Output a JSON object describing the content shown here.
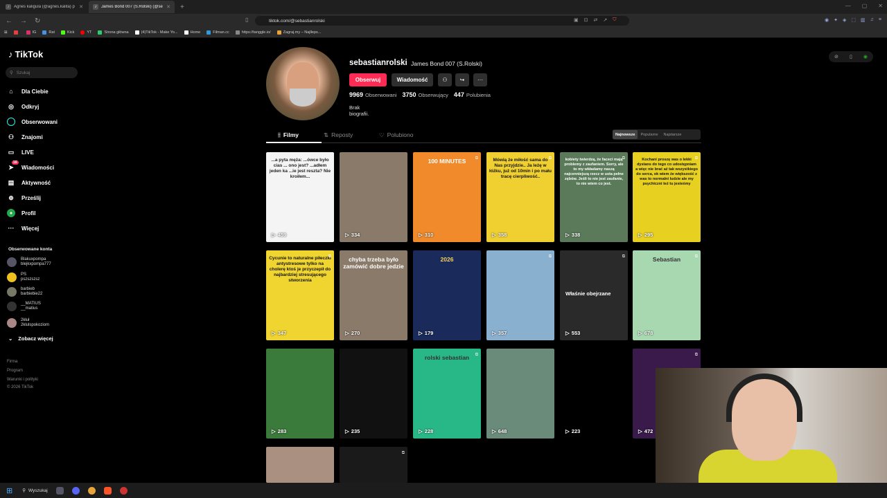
{
  "browser": {
    "tabs": [
      {
        "title": "Agnes kaligula (@agnes.kalita) p",
        "active": false
      },
      {
        "title": "James Bond 007 (S.Rolski) (@se",
        "active": true
      }
    ],
    "new_tab": "+",
    "url": "tiktok.com/@sebastianrolski",
    "bookmarks": [
      {
        "label": "",
        "color": "#e04040"
      },
      {
        "label": "IG",
        "color": "#d6336c"
      },
      {
        "label": "Rat",
        "color": "#4a90e2"
      },
      {
        "label": "Kick",
        "color": "#53fc18"
      },
      {
        "label": "YT",
        "color": "#ff0000"
      },
      {
        "label": "Strona główna",
        "color": "#2ecc71"
      },
      {
        "label": "(4)TikTok - Make Yo...",
        "color": "#ffffff"
      },
      {
        "label": "Home",
        "color": "#ffffff"
      },
      {
        "label": "Filman.cc",
        "color": "#3498db"
      },
      {
        "label": "https://tanggle.io/",
        "color": "#888888"
      },
      {
        "label": "Zagraj.my – Najlleps...",
        "color": "#e8a33c"
      }
    ]
  },
  "sidebar": {
    "logo": "TikTok",
    "search_placeholder": "Szukaj",
    "nav": [
      {
        "label": "Dla Ciebie",
        "icon": "home-icon"
      },
      {
        "label": "Odkryj",
        "icon": "compass-icon"
      },
      {
        "label": "Obserwowani",
        "icon": "following-icon"
      },
      {
        "label": "Znajomi",
        "icon": "friends-icon"
      },
      {
        "label": "LIVE",
        "icon": "live-icon"
      },
      {
        "label": "Wiadomości",
        "icon": "messages-icon",
        "badge": "16"
      },
      {
        "label": "Aktywność",
        "icon": "activity-icon"
      },
      {
        "label": "Prześlij",
        "icon": "upload-icon"
      },
      {
        "label": "Profil",
        "icon": "profile-icon"
      },
      {
        "label": "Więcej",
        "icon": "more-icon"
      }
    ],
    "followed_heading": "Obserwowane konta",
    "followed": [
      {
        "name": "Blakuxpompa",
        "handle": "blejkxpompa777"
      },
      {
        "name": "PS",
        "handle": "pszszszsz"
      },
      {
        "name": "barbieb",
        "handle": "barbiebie22"
      },
      {
        "name": "__MATIUS",
        "handle": "__matius"
      },
      {
        "name": "2kłuł",
        "handle": "2klulspokoziom"
      }
    ],
    "see_more": "Zobacz więcej",
    "footer": [
      "Firma",
      "Program",
      "Warunki i polityki",
      "© 2026 TikTok"
    ]
  },
  "profile": {
    "username": "sebastianrolski",
    "display_name": "James Bond 007 (S.Rolski)",
    "follow_label": "Obserwuj",
    "message_label": "Wiadomość",
    "stats": [
      {
        "value": "9969",
        "label": "Obserwowani"
      },
      {
        "value": "3750",
        "label": "Obserwujący"
      },
      {
        "value": "447",
        "label": "Polubienia"
      }
    ],
    "bio": "Brak biografii.",
    "tabs": [
      "Filmy",
      "Reposty",
      "Polubiono"
    ],
    "sort": [
      "Najnowsze",
      "Popularne",
      "Najstarsze"
    ]
  },
  "videos": [
    {
      "views": "459",
      "caption": "...a pyta męża: ...ówce było cias ... ono jest? ...adłem jeden ka ...ie jest reszta? Nie kroiłem...",
      "bg": "#f4f4f4",
      "fg": "#222",
      "pinned": false
    },
    {
      "views": "334",
      "caption": "",
      "bg": "#8a7a6a",
      "fg": "#fff",
      "pinned": false
    },
    {
      "views": "310",
      "caption": "100 MINUTES",
      "bg": "#f08a2a",
      "fg": "#fff",
      "pinned": true
    },
    {
      "views": "358",
      "caption": "Mówią że miłość sama do Nas przyjdzie.. Ja leżę w łóżku, już od 10min i po mału tracę cierpliwość..",
      "bg": "#f0d030",
      "fg": "#111",
      "pinned": true
    },
    {
      "views": "338",
      "caption": "kobiety twierdzą, że faceci mają problemy z zaufaniem. Sorry, ale to my wkładamy naszą najcenniejszą rzecz w usta pełne zębów. Jeśli to nie jest zaufanie, to nie wiem co jest.",
      "bg": "#5a7a5a",
      "fg": "#fff",
      "pinned": true
    },
    {
      "views": "295",
      "caption": "Kochani proszę was o lekki dystans do tego co udostępniam a więc nie brać aż tak wszystkiego do serca, ok wiem że większość z was to normalni ludzie ale my psychiczni też tu jesteśmy",
      "bg": "#e8d020",
      "fg": "#111",
      "pinned": true
    },
    {
      "views": "347",
      "caption": "Cycunie to naturalne piłeczki antystresowe tylko na cholerę ktoś je przyczepił do najbardziej stresującego stworzenia",
      "bg": "#f0d430",
      "fg": "#111",
      "pinned": true
    },
    {
      "views": "270",
      "caption": "chyba trzeba było zamówić dobre jedzie",
      "bg": "#8a7a6a",
      "fg": "#fff",
      "pinned": false
    },
    {
      "views": "179",
      "caption": "2026",
      "bg": "#1a2a5a",
      "fg": "#f4d060",
      "pinned": false
    },
    {
      "views": "357",
      "caption": "",
      "bg": "#8ab0d0",
      "fg": "#fff",
      "pinned": true
    },
    {
      "views": "553",
      "caption": "",
      "bg": "#2a2a2a",
      "fg": "#fff",
      "pinned": true,
      "watched": "Właśnie obejrzane"
    },
    {
      "views": "678",
      "caption": "Sebastian",
      "bg": "#a8d8b0",
      "fg": "#333",
      "pinned": true
    },
    {
      "views": "283",
      "caption": "",
      "bg": "#3a7a3a",
      "fg": "#fff",
      "pinned": false
    },
    {
      "views": "235",
      "caption": "",
      "bg": "#111",
      "fg": "#fff",
      "pinned": false
    },
    {
      "views": "228",
      "caption": "rolski sebastian",
      "bg": "#28b888",
      "fg": "#333",
      "pinned": true
    },
    {
      "views": "648",
      "caption": "",
      "bg": "#6a8a7a",
      "fg": "#fff",
      "pinned": false
    },
    {
      "views": "223",
      "caption": "",
      "bg": "#000",
      "fg": "#fff",
      "pinned": false
    },
    {
      "views": "472",
      "caption": "",
      "bg": "#3a1a4a",
      "fg": "#f4c040",
      "pinned": true
    },
    {
      "views": "",
      "caption": "",
      "bg": "#aa9080",
      "fg": "#fff",
      "pinned": false
    },
    {
      "views": "",
      "caption": "",
      "bg": "#1a1a1a",
      "fg": "#fff",
      "pinned": true
    }
  ],
  "taskbar": {
    "search_label": "Wyszukaj"
  }
}
